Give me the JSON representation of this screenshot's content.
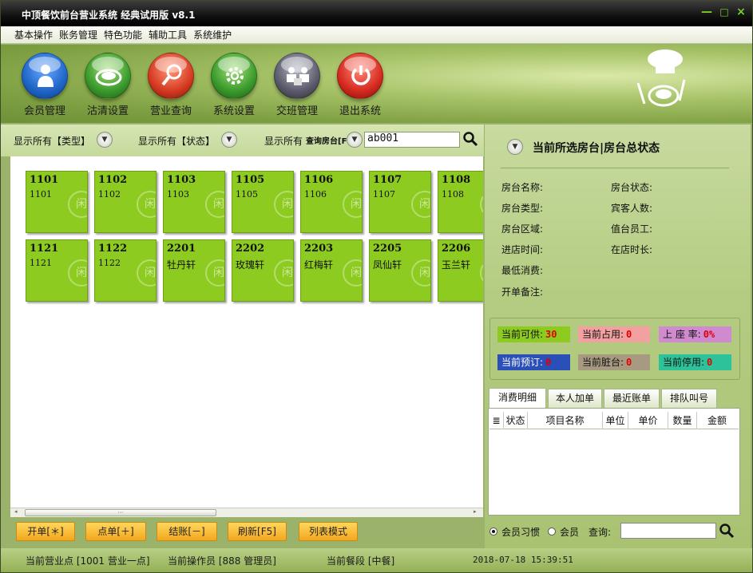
{
  "window": {
    "title": "中顶餐饮前台营业系统 经典试用版 v8.1",
    "minimize": "—",
    "maximize": "□",
    "close": "×"
  },
  "menu": [
    "基本操作",
    "账务管理",
    "特色功能",
    "辅助工具",
    "系统维护"
  ],
  "toolbar": [
    {
      "label": "会员管理",
      "icon": "member-icon",
      "color": "#1f66c8"
    },
    {
      "label": "沽清设置",
      "icon": "plate-icon",
      "color": "#3a9a2c"
    },
    {
      "label": "营业查询",
      "icon": "search-icon",
      "color": "#d63a22"
    },
    {
      "label": "系统设置",
      "icon": "gear-icon",
      "color": "#3a9a2c"
    },
    {
      "label": "交班管理",
      "icon": "people-icon",
      "color": "#5b5b6b"
    },
    {
      "label": "退出系统",
      "icon": "power-icon",
      "color": "#d62a1f"
    }
  ],
  "filters": {
    "type": "显示所有【类型】",
    "status": "显示所有【状态】",
    "area": "显示所有",
    "search_label": "查询房台[F9]",
    "search_value": "ab001"
  },
  "rooms": [
    {
      "no": "1101",
      "name": "1101"
    },
    {
      "no": "1102",
      "name": "1102"
    },
    {
      "no": "1103",
      "name": "1103"
    },
    {
      "no": "1105",
      "name": "1105"
    },
    {
      "no": "1106",
      "name": "1106"
    },
    {
      "no": "1107",
      "name": "1107"
    },
    {
      "no": "1108",
      "name": "1108"
    },
    {
      "no": "1121",
      "name": "1121"
    },
    {
      "no": "1122",
      "name": "1122"
    },
    {
      "no": "2201",
      "name": "牡丹轩"
    },
    {
      "no": "2202",
      "name": "玫瑰轩"
    },
    {
      "no": "2203",
      "name": "红梅轩"
    },
    {
      "no": "2205",
      "name": "凤仙轩"
    },
    {
      "no": "2206",
      "name": "玉兰轩"
    }
  ],
  "room_badge": "闲",
  "buttons": [
    "开单[＊]",
    "点单[＋]",
    "结账[－]",
    "刷新[F5]",
    "列表模式"
  ],
  "panel": {
    "title": "当前所选房台|房台总状态",
    "left_fields": [
      "房台名称:",
      "房台类型:",
      "房台区域:",
      "进店时间:",
      "最低消费:",
      "开单备注:"
    ],
    "right_fields": [
      "房台状态:",
      "宾客人数:",
      "值台员工:",
      "在店时长:"
    ],
    "stats": [
      {
        "label": "当前可供:",
        "value": "30",
        "bg": "#8ecb20"
      },
      {
        "label": "当前占用:",
        "value": "0",
        "bg": "#f2a0a0"
      },
      {
        "label": "上 座 率:",
        "value": "0%",
        "bg": "#d08ad0"
      },
      {
        "label": "当前预订:",
        "value": "0",
        "bg": "#2b4fb8"
      },
      {
        "label": "当前脏台:",
        "value": "0",
        "bg": "#a89a80"
      },
      {
        "label": "当前停用:",
        "value": "0",
        "bg": "#2ec29a"
      }
    ],
    "tabs": [
      "消费明细",
      "本人加单",
      "最近账单",
      "排队叫号"
    ],
    "columns": [
      "状态",
      "项目名称",
      "单位",
      "单价",
      "数量",
      "金额"
    ],
    "radio1": "会员习惯",
    "radio2": "会员",
    "query_label": "查询:"
  },
  "status": {
    "point": "当前营业点 [1001 营业一点]",
    "operator": "当前操作员 [888 管理员]",
    "meal": "当前餐段 [中餐]",
    "time": "2018-07-18 15:39:51"
  }
}
